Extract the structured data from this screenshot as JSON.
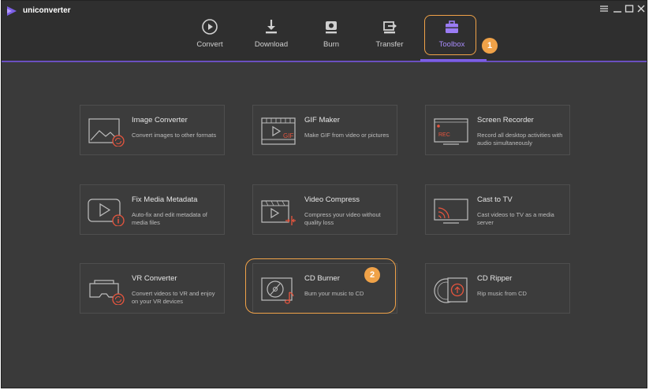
{
  "app": {
    "name": "uniconverter"
  },
  "window_controls": [
    "menu-icon",
    "minimize-icon",
    "maximize-icon",
    "close-icon"
  ],
  "tabs": [
    {
      "label": "Convert",
      "icon": "convert-icon",
      "active": false
    },
    {
      "label": "Download",
      "icon": "download-icon",
      "active": false
    },
    {
      "label": "Burn",
      "icon": "burn-icon",
      "active": false
    },
    {
      "label": "Transfer",
      "icon": "transfer-icon",
      "active": false
    },
    {
      "label": "Toolbox",
      "icon": "toolbox-icon",
      "active": true
    }
  ],
  "callouts": [
    "1",
    "2"
  ],
  "tools": [
    {
      "title": "Image Converter",
      "desc": "Convert images to other formats",
      "icon": "image-converter-icon"
    },
    {
      "title": "GIF Maker",
      "desc": "Make GIF from video or pictures",
      "icon": "gif-maker-icon"
    },
    {
      "title": "Screen Recorder",
      "desc": "Record all desktop activities with audio simultaneously",
      "icon": "screen-recorder-icon"
    },
    {
      "title": "Fix Media Metadata",
      "desc": "Auto-fix and edit metadata of media files",
      "icon": "fix-metadata-icon"
    },
    {
      "title": "Video Compress",
      "desc": "Compress your video without quality loss",
      "icon": "video-compress-icon"
    },
    {
      "title": "Cast to TV",
      "desc": "Cast videos to TV as a media server",
      "icon": "cast-tv-icon"
    },
    {
      "title": "VR Converter",
      "desc": "Convert videos to VR and enjoy on your VR devices",
      "icon": "vr-converter-icon"
    },
    {
      "title": "CD Burner",
      "desc": "Burn your music to CD",
      "icon": "cd-burner-icon"
    },
    {
      "title": "CD Ripper",
      "desc": "Rip music from CD",
      "icon": "cd-ripper-icon"
    }
  ],
  "icon_labels": {
    "gif": "GIF",
    "rec": "REC"
  },
  "colors": {
    "accent": "#7c5fe6",
    "callout": "#f0a248",
    "icon_red": "#e8553e",
    "background": "#3a3a3a"
  }
}
